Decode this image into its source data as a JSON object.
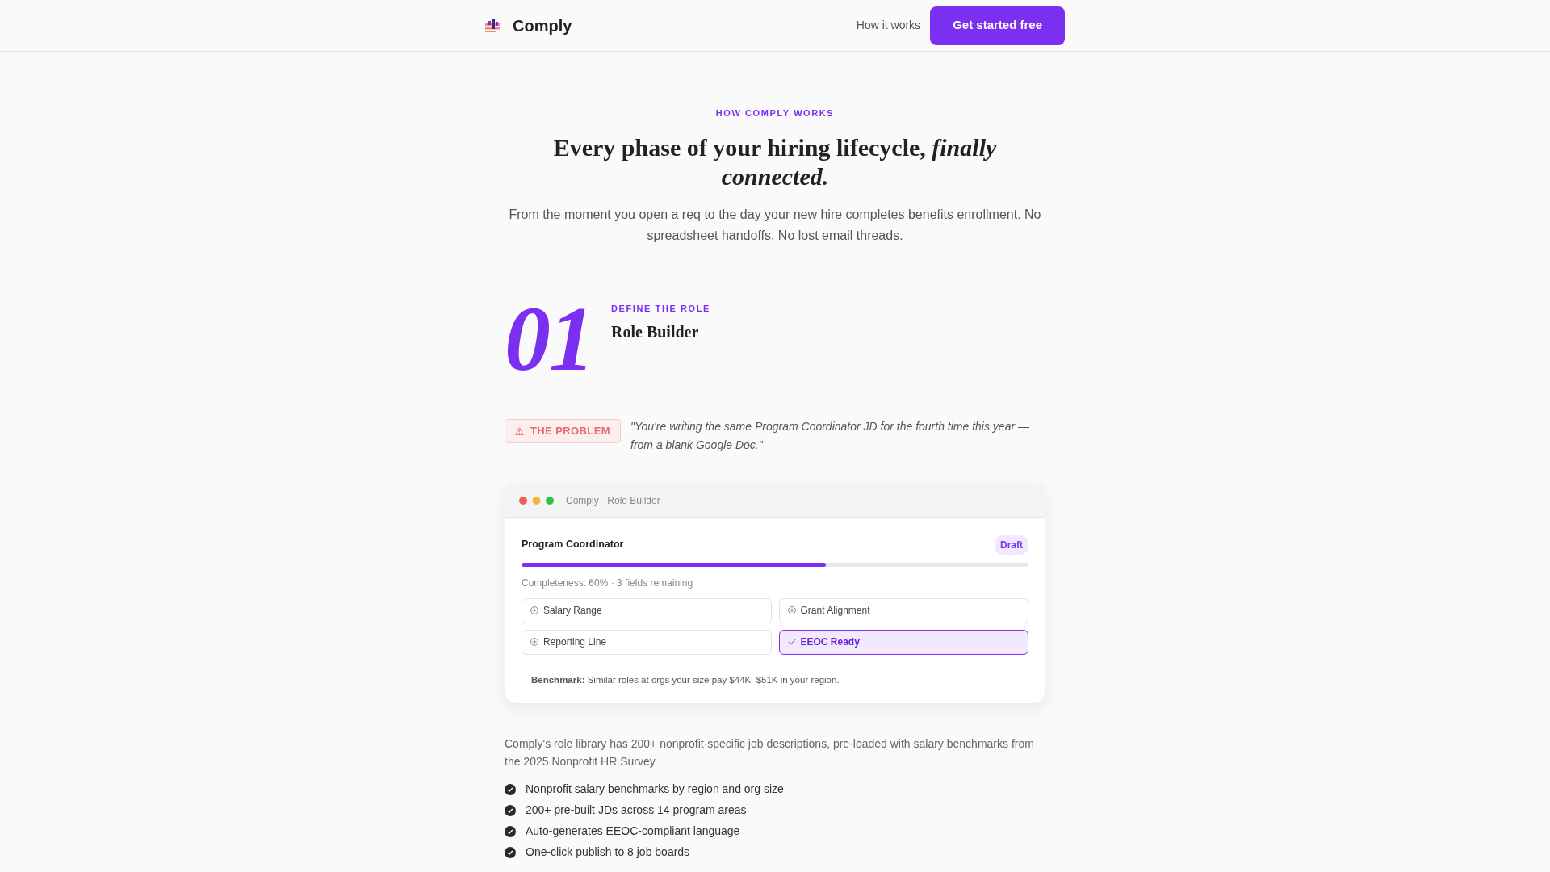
{
  "navbar": {
    "brand": "Comply",
    "links": [
      {
        "label": "How it works"
      }
    ],
    "cta": "Get started free"
  },
  "hero": {
    "eyebrow": "HOW COMPLY WORKS",
    "title": "Every phase of your hiring lifecycle, *finally connected.*",
    "intro": "From the moment you open a req to the day your new hire completes benefits enrollment. No spreadsheet handoffs. No lost email threads."
  },
  "steps": [
    {
      "number": "01",
      "eyebrow": "DEFINE THE ROLE",
      "title": "Role Builder",
      "problem": {
        "label": "THE PROBLEM",
        "quote": "\"You're writing the same Program Coordinator JD for the fourth time this year — from a blank Google Doc.\""
      },
      "mockup": {
        "window_title": "Comply · Role Builder",
        "role": "Program Coordinator",
        "status": "Draft",
        "progress": {
          "level": 0.6,
          "text": "Completeness: 60% · 3 fields remaining"
        },
        "fields": [
          {
            "label": "Salary Range",
            "done": false
          },
          {
            "label": "Grant Alignment",
            "done": false
          },
          {
            "label": "Reporting Line",
            "done": false
          },
          {
            "label": "EEOC Ready",
            "done": true
          }
        ],
        "benchmark": "**Benchmark:** Similar roles at orgs your size pay $44K–$51K in your region."
      },
      "description": "Comply's role library has 200+ nonprofit-specific job descriptions, pre-loaded with salary benchmarks from the 2025 Nonprofit HR Survey.",
      "features": [
        "Nonprofit salary benchmarks by region and org size",
        "200+ pre-built JDs across 14 program areas",
        "Auto-generates EEOC-compliant language",
        "One-click publish to 8 job boards"
      ]
    }
  ]
}
